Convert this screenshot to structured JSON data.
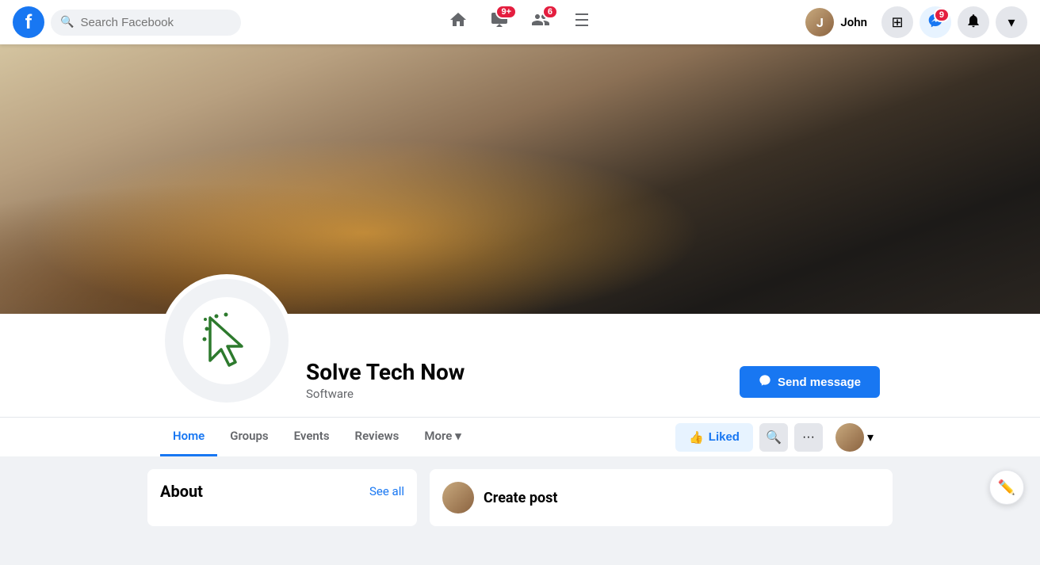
{
  "navbar": {
    "logo": "f",
    "search_placeholder": "Search Facebook",
    "nav_items": [
      {
        "id": "home",
        "icon": "🏠",
        "badge": null
      },
      {
        "id": "watch",
        "icon": "📺",
        "badge": "9+",
        "badge_label": "9 plus"
      },
      {
        "id": "friends",
        "icon": "👥",
        "badge": "6"
      },
      {
        "id": "marketplace",
        "icon": "🏪",
        "badge": null
      }
    ],
    "user_name": "John",
    "icons_right": [
      {
        "id": "grid",
        "icon": "⊞",
        "label": "App menu"
      },
      {
        "id": "messenger",
        "icon": "💬",
        "badge": "9"
      },
      {
        "id": "notifications",
        "icon": "🔔",
        "badge": null
      },
      {
        "id": "dropdown",
        "icon": "▾",
        "label": "Account menu"
      }
    ]
  },
  "page": {
    "name": "Solve Tech Now",
    "category": "Software",
    "tabs": [
      {
        "id": "home",
        "label": "Home",
        "active": true
      },
      {
        "id": "groups",
        "label": "Groups"
      },
      {
        "id": "events",
        "label": "Events"
      },
      {
        "id": "reviews",
        "label": "Reviews"
      },
      {
        "id": "more",
        "label": "More"
      }
    ],
    "actions": {
      "liked": "Liked",
      "send_message": "Send message",
      "more_options": "···"
    },
    "about_title": "About",
    "see_all": "See all",
    "create_post": "Create post"
  }
}
